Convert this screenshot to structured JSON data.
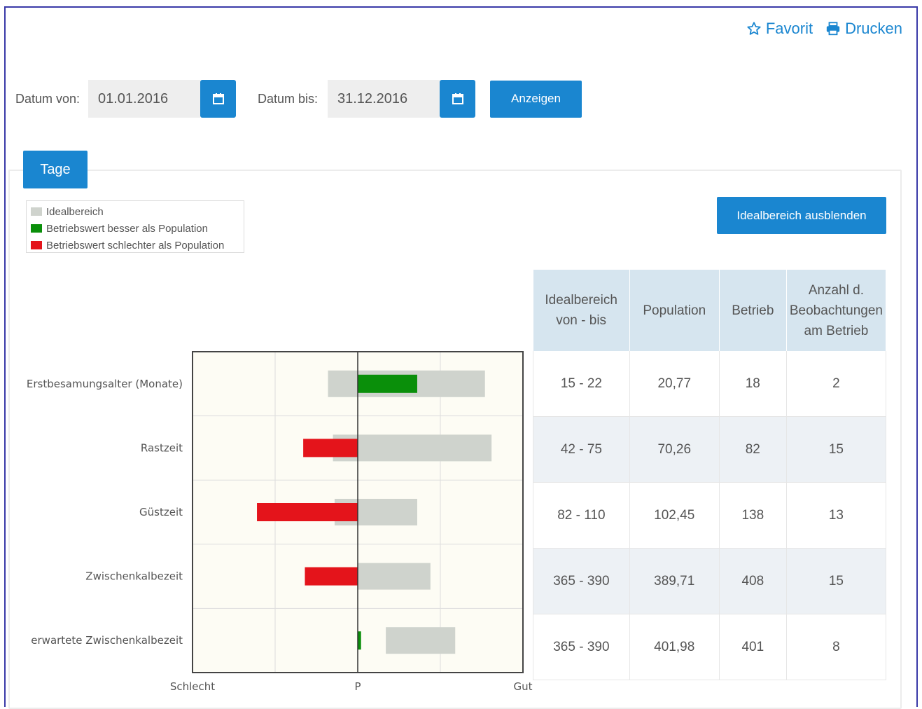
{
  "header": {
    "favorite_label": "Favorit",
    "print_label": "Drucken"
  },
  "filters": {
    "from_label": "Datum von:",
    "from_value": "01.01.2016",
    "to_label": "Datum bis:",
    "to_value": "31.12.2016",
    "show_label": "Anzeigen"
  },
  "tab": {
    "label": "Tage"
  },
  "legend": {
    "items": [
      {
        "label": "Idealbereich",
        "color": "#cfd3cd"
      },
      {
        "label": "Betriebswert besser als Population",
        "color": "#0a8f0a"
      },
      {
        "label": "Betriebswert schlechter als Population",
        "color": "#e4141b"
      }
    ]
  },
  "hide_button": {
    "label": "Idealbereich ausblenden"
  },
  "table": {
    "headers": [
      "Idealbereich von - bis",
      "Population",
      "Betrieb",
      "Anzahl d. Beobachtungen am Betrieb"
    ],
    "rows": [
      [
        "15 - 22",
        "20,77",
        "18",
        "2"
      ],
      [
        "42 - 75",
        "70,26",
        "82",
        "15"
      ],
      [
        "82 - 110",
        "102,45",
        "138",
        "13"
      ],
      [
        "365 - 390",
        "389,71",
        "408",
        "15"
      ],
      [
        "365 - 390",
        "401,98",
        "401",
        "8"
      ]
    ]
  },
  "chart_data": {
    "type": "bar",
    "orientation": "horizontal",
    "x_ticks": [
      "Schlecht",
      "P",
      "Gut"
    ],
    "xlim": [
      -1,
      1
    ],
    "grid": true,
    "categories": [
      "Erstbesamungsalter (Monate)",
      "Rastzeit",
      "Güstzeit",
      "Zwischenkalbezeit",
      "erwartete Zwischenkalbezeit"
    ],
    "ideal_range": [
      [
        -0.18,
        0.77
      ],
      [
        -0.15,
        0.81
      ],
      [
        -0.14,
        0.36
      ],
      [
        0,
        0.44
      ],
      [
        0.17,
        0.59
      ]
    ],
    "value": [
      0.36,
      -0.33,
      -0.61,
      -0.32,
      0.02
    ],
    "status": [
      "besser",
      "schlechter",
      "schlechter",
      "schlechter",
      "besser"
    ],
    "colors": {
      "ideal": "#cfd3cd",
      "besser": "#0a8f0a",
      "schlechter": "#e4141b",
      "plot_bg": "#fdfcf4"
    }
  }
}
